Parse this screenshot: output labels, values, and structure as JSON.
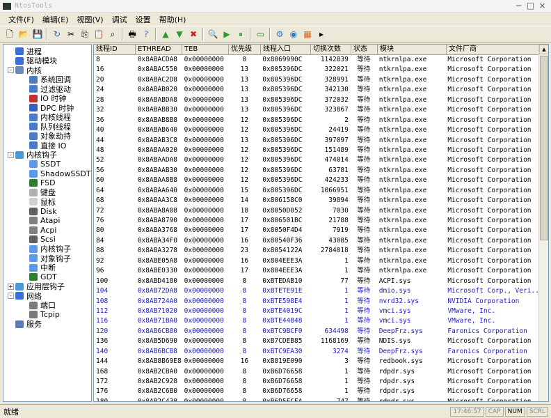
{
  "window": {
    "title": "NtosTools"
  },
  "menu": [
    "文件(F)",
    "编辑(E)",
    "视图(V)",
    "调试",
    "设置",
    "帮助(H)"
  ],
  "toolbar_icons": [
    "new-icon",
    "open-icon",
    "save-icon",
    "sep",
    "refresh-icon",
    "cut-icon",
    "copy-icon",
    "paste-icon",
    "find-icon",
    "sep",
    "print-icon",
    "help-icon",
    "sep",
    "up-icon",
    "down-icon",
    "close-icon",
    "sep",
    "search-icon",
    "play-icon",
    "pause-icon",
    "sep",
    "window-icon",
    "sep",
    "gear-icon",
    "globe-icon",
    "color-icon",
    "more-icon"
  ],
  "tree": [
    {
      "label": "进程",
      "level": 0,
      "color": "#3a6fd8"
    },
    {
      "label": "驱动模块",
      "level": 0,
      "color": "#3a6fd8"
    },
    {
      "label": "内核",
      "level": 0,
      "color": "#6a8ab8",
      "expander": "-"
    },
    {
      "label": "系统回调",
      "level": 1,
      "color": "#4a7ac8"
    },
    {
      "label": "过滤驱动",
      "level": 1,
      "color": "#4a7ac8"
    },
    {
      "label": "IO 时钟",
      "level": 1,
      "color": "#c03030"
    },
    {
      "label": "DPC 时钟",
      "level": 1,
      "color": "#3060c0"
    },
    {
      "label": "内核线程",
      "level": 1,
      "color": "#4a7ac8"
    },
    {
      "label": "队列线程",
      "level": 1,
      "color": "#4a7ac8"
    },
    {
      "label": "对象劫持",
      "level": 1,
      "color": "#4a7ac8"
    },
    {
      "label": "直接 IO",
      "level": 1,
      "color": "#4a7ac8"
    },
    {
      "label": "内核钩子",
      "level": 0,
      "color": "#4a9ad8",
      "expander": "-"
    },
    {
      "label": "SSDT",
      "level": 1,
      "color": "#5a9ae8"
    },
    {
      "label": "ShadowSSDT",
      "level": 1,
      "color": "#5a9ae8"
    },
    {
      "label": "FSD",
      "level": 1,
      "color": "#2e7d2e"
    },
    {
      "label": "键盘",
      "level": 1,
      "color": "#b0b0b0"
    },
    {
      "label": "鼠标",
      "level": 1,
      "color": "#d0d0d0"
    },
    {
      "label": "Disk",
      "level": 1,
      "color": "#606060"
    },
    {
      "label": "Atapi",
      "level": 1,
      "color": "#808080"
    },
    {
      "label": "Acpi",
      "level": 1,
      "color": "#808080"
    },
    {
      "label": "Scsi",
      "level": 1,
      "color": "#606060"
    },
    {
      "label": "内核钩子",
      "level": 1,
      "color": "#5a9ae8"
    },
    {
      "label": "对象钩子",
      "level": 1,
      "color": "#5a9ae8"
    },
    {
      "label": "中断",
      "level": 1,
      "color": "#5a9ae8"
    },
    {
      "label": "GDT",
      "level": 1,
      "color": "#2e7d2e"
    },
    {
      "label": "应用层钩子",
      "level": 0,
      "color": "#4a9ad8",
      "expander": "+"
    },
    {
      "label": "网络",
      "level": 0,
      "color": "#3a6fd8",
      "expander": "-"
    },
    {
      "label": "端口",
      "level": 1,
      "color": "#7a7a7a"
    },
    {
      "label": "Tcpip",
      "level": 1,
      "color": "#7a7a7a"
    },
    {
      "label": "服务",
      "level": 0,
      "color": "#5a7ab8"
    }
  ],
  "columns": [
    "线程ID",
    "ETHREAD",
    "TEB",
    "优先级",
    "线程入口",
    "切换次数",
    "状态",
    "模块",
    "文件厂商"
  ],
  "rows": [
    [
      "8",
      "0x8ABACDA8",
      "0x00000000",
      "0",
      "0x8069990C",
      "1142839",
      "等待",
      "ntkrnlpa.exe",
      "Microsoft Corporation",
      false
    ],
    [
      "16",
      "0x8ABAC550",
      "0x00000000",
      "13",
      "0x805396DC",
      "322021",
      "等待",
      "ntkrnlpa.exe",
      "Microsoft Corporation",
      false
    ],
    [
      "20",
      "0x8ABAC2D8",
      "0x00000000",
      "13",
      "0x805396DC",
      "328991",
      "等待",
      "ntkrnlpa.exe",
      "Microsoft Corporation",
      false
    ],
    [
      "24",
      "0x8ABAB020",
      "0x00000000",
      "13",
      "0x805396DC",
      "342130",
      "等待",
      "ntkrnlpa.exe",
      "Microsoft Corporation",
      false
    ],
    [
      "28",
      "0x8ABABDA8",
      "0x00000000",
      "13",
      "0x805396DC",
      "372032",
      "等待",
      "ntkrnlpa.exe",
      "Microsoft Corporation",
      false
    ],
    [
      "32",
      "0x8ABABB30",
      "0x00000000",
      "13",
      "0x805396DC",
      "323867",
      "等待",
      "ntkrnlpa.exe",
      "Microsoft Corporation",
      false
    ],
    [
      "36",
      "0x8ABAB8B8",
      "0x00000000",
      "12",
      "0x805396DC",
      "2",
      "等待",
      "ntkrnlpa.exe",
      "Microsoft Corporation",
      false
    ],
    [
      "40",
      "0x8ABAB640",
      "0x00000000",
      "12",
      "0x805396DC",
      "24419",
      "等待",
      "ntkrnlpa.exe",
      "Microsoft Corporation",
      false
    ],
    [
      "44",
      "0x8ABAB3C8",
      "0x00000000",
      "13",
      "0x805396DC",
      "397097",
      "等待",
      "ntkrnlpa.exe",
      "Microsoft Corporation",
      false
    ],
    [
      "48",
      "0x8ABAA020",
      "0x00000000",
      "12",
      "0x805396DC",
      "151489",
      "等待",
      "ntkrnlpa.exe",
      "Microsoft Corporation",
      false
    ],
    [
      "52",
      "0x8ABAADA8",
      "0x00000000",
      "12",
      "0x805396DC",
      "474014",
      "等待",
      "ntkrnlpa.exe",
      "Microsoft Corporation",
      false
    ],
    [
      "56",
      "0x8ABAAB30",
      "0x00000000",
      "12",
      "0x805396DC",
      "63781",
      "等待",
      "ntkrnlpa.exe",
      "Microsoft Corporation",
      false
    ],
    [
      "60",
      "0x8ABAA8B8",
      "0x00000000",
      "12",
      "0x805396DC",
      "424233",
      "等待",
      "ntkrnlpa.exe",
      "Microsoft Corporation",
      false
    ],
    [
      "64",
      "0x8ABAA640",
      "0x00000000",
      "15",
      "0x805396DC",
      "1066951",
      "等待",
      "ntkrnlpa.exe",
      "Microsoft Corporation",
      false
    ],
    [
      "68",
      "0x8ABAA3C8",
      "0x00000000",
      "14",
      "0x806158C0",
      "39894",
      "等待",
      "ntkrnlpa.exe",
      "Microsoft Corporation",
      false
    ],
    [
      "72",
      "0x8ABA8A08",
      "0x00000000",
      "18",
      "0x8050D052",
      "7030",
      "等待",
      "ntkrnlpa.exe",
      "Microsoft Corporation",
      false
    ],
    [
      "76",
      "0x8ABA8790",
      "0x00000000",
      "17",
      "0x806501BC",
      "21788",
      "等待",
      "ntkrnlpa.exe",
      "Microsoft Corporation",
      false
    ],
    [
      "80",
      "0x8ABA3768",
      "0x00000000",
      "17",
      "0x8050F4D4",
      "7919",
      "等待",
      "ntkrnlpa.exe",
      "Microsoft Corporation",
      false
    ],
    [
      "84",
      "0x8ABA34F0",
      "0x00000000",
      "16",
      "0x80540F36",
      "43085",
      "等待",
      "ntkrnlpa.exe",
      "Microsoft Corporation",
      false
    ],
    [
      "88",
      "0x8ABA3278",
      "0x00000000",
      "23",
      "0x8054122A",
      "2784018",
      "等待",
      "ntkrnlpa.exe",
      "Microsoft Corporation",
      false
    ],
    [
      "92",
      "0x8ABE05A8",
      "0x00000000",
      "16",
      "0x804EEE3A",
      "1",
      "等待",
      "ntkrnlpa.exe",
      "Microsoft Corporation",
      false
    ],
    [
      "96",
      "0x8ABE0330",
      "0x00000000",
      "17",
      "0x804EEE3A",
      "1",
      "等待",
      "ntkrnlpa.exe",
      "Microsoft Corporation",
      false
    ],
    [
      "100",
      "0x8ABD4180",
      "0x00000000",
      "8",
      "0xBTEDAB10",
      "77",
      "等待",
      "ACPI.sys",
      "Microsoft Corporation",
      false
    ],
    [
      "104",
      "0x8AB72DA8",
      "0x00000000",
      "8",
      "0xBTETE91E",
      "1",
      "等待",
      "dmio.sys",
      "Microsoft Corp., Veri...",
      true
    ],
    [
      "108",
      "0x8AB724A0",
      "0x00000000",
      "8",
      "0xBTE598E4",
      "1",
      "等待",
      "nvrd32.sys",
      "NVIDIA Corporation",
      true
    ],
    [
      "112",
      "0x8AB71020",
      "0x00000000",
      "8",
      "0xBTE4019C",
      "1",
      "等待",
      "vmci.sys",
      "VMware, Inc.",
      true
    ],
    [
      "116",
      "0x8AB71BA0",
      "0x00000000",
      "8",
      "0xBTE44848",
      "1",
      "等待",
      "vmci.sys",
      "VMware, Inc.",
      true
    ],
    [
      "120",
      "0x8AB6CB80",
      "0x00000000",
      "8",
      "0xBTC9BCF0",
      "634498",
      "等待",
      "DeepFrz.sys",
      "Faronics Corporation",
      true
    ],
    [
      "136",
      "0x8AB5D690",
      "0x00000000",
      "8",
      "0xB7CDEB85",
      "1168169",
      "等待",
      "NDIS.sys",
      "Microsoft Corporation",
      false
    ],
    [
      "140",
      "0x8AB6BCB8",
      "0x00000000",
      "8",
      "0xBTC9EA30",
      "3274",
      "等待",
      "DeepFrz.sys",
      "Faronics Corporation",
      true
    ],
    [
      "144",
      "0x8AB8B69E8",
      "0x00000000",
      "16",
      "0xB819E090",
      "3",
      "等待",
      "redbook.sys",
      "Microsoft Corporation",
      false
    ],
    [
      "168",
      "0x8AB2CBA0",
      "0x00000000",
      "8",
      "0xB6D76658",
      "1",
      "等待",
      "rdpdr.sys",
      "Microsoft Corporation",
      false
    ],
    [
      "172",
      "0x8AB2C928",
      "0x00000000",
      "8",
      "0xB6D76658",
      "1",
      "等待",
      "rdpdr.sys",
      "Microsoft Corporation",
      false
    ],
    [
      "176",
      "0x8AB2C6B0",
      "0x00000000",
      "8",
      "0xB6D76658",
      "1",
      "等待",
      "rdpdr.sys",
      "Microsoft Corporation",
      false
    ],
    [
      "180",
      "0x8AB2C438",
      "0x00000000",
      "8",
      "0xB6D5FCFA",
      "747",
      "等待",
      "rdpdr.sys",
      "Microsoft Corporation",
      false
    ]
  ],
  "status": {
    "left": "就绪",
    "time": "17:46:57",
    "caps": "CAP",
    "num": "NUM",
    "scrl": "SCRL"
  }
}
